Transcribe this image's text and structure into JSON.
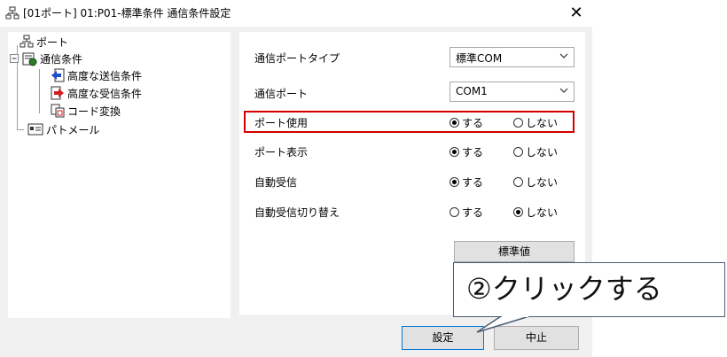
{
  "window": {
    "title": "[01ポート] 01:P01-標準条件 通信条件設定",
    "close_label": "✕"
  },
  "tree": {
    "items": [
      {
        "label": "ポート",
        "icon": "network-icon"
      },
      {
        "label": "通信条件",
        "icon": "comm-settings-icon"
      },
      {
        "label": "高度な送信条件",
        "icon": "send-icon"
      },
      {
        "label": "高度な受信条件",
        "icon": "receive-icon"
      },
      {
        "label": "コード変換",
        "icon": "code-convert-icon"
      },
      {
        "label": "パトメール",
        "icon": "mail-card-icon"
      }
    ]
  },
  "settings": {
    "port_type": {
      "label": "通信ポートタイプ",
      "value": "標準COM"
    },
    "port": {
      "label": "通信ポート",
      "value": "COM1"
    },
    "port_use": {
      "label": "ポート使用",
      "yes": "する",
      "no": "しない",
      "selected": "yes"
    },
    "port_display": {
      "label": "ポート表示",
      "yes": "する",
      "no": "しない",
      "selected": "yes"
    },
    "auto_receive": {
      "label": "自動受信",
      "yes": "する",
      "no": "しない",
      "selected": "yes"
    },
    "auto_receive_switch": {
      "label": "自動受信切り替え",
      "yes": "する",
      "no": "しない",
      "selected": "no"
    },
    "default_button": "標準値"
  },
  "footer": {
    "ok_label": "設定",
    "cancel_label": "中止"
  },
  "callout": {
    "text": "②クリックする"
  },
  "colors": {
    "highlight": "#d40000",
    "focus_border": "#0078d7",
    "panel": "#f0f0f0"
  }
}
